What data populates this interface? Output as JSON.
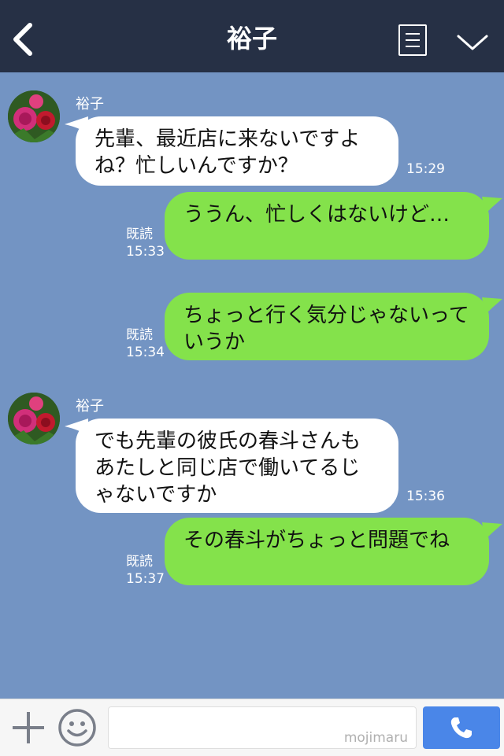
{
  "header": {
    "title": "裕子"
  },
  "messages": [
    {
      "type": "in",
      "sender": "裕子",
      "text": "先輩、最近店に来ないですよね？忙しいんですか？",
      "time": "15:29"
    },
    {
      "type": "out",
      "read": "既読",
      "text": "ううん、忙しくはないけど…",
      "time": "15:33"
    },
    {
      "type": "out",
      "read": "既読",
      "text": "ちょっと行く気分じゃないっていうか",
      "time": "15:34"
    },
    {
      "type": "in",
      "sender": "裕子",
      "text": "でも先輩の彼氏の春斗さんもあたしと同じ店で働いてるじゃないですか",
      "time": "15:36"
    },
    {
      "type": "out",
      "read": "既読",
      "text": "その春斗がちょっと問題でね",
      "time": "15:37"
    }
  ],
  "footer": {
    "watermark": "mojimaru"
  },
  "colors": {
    "header_bg": "#263045",
    "chat_bg": "#7394c3",
    "incoming_bubble": "#ffffff",
    "outgoing_bubble": "#84e24b",
    "call_button": "#4a86e8"
  },
  "icons": [
    "back-arrow-icon",
    "menu-list-icon",
    "chevron-down-icon",
    "plus-icon",
    "emoji-icon",
    "phone-icon"
  ]
}
